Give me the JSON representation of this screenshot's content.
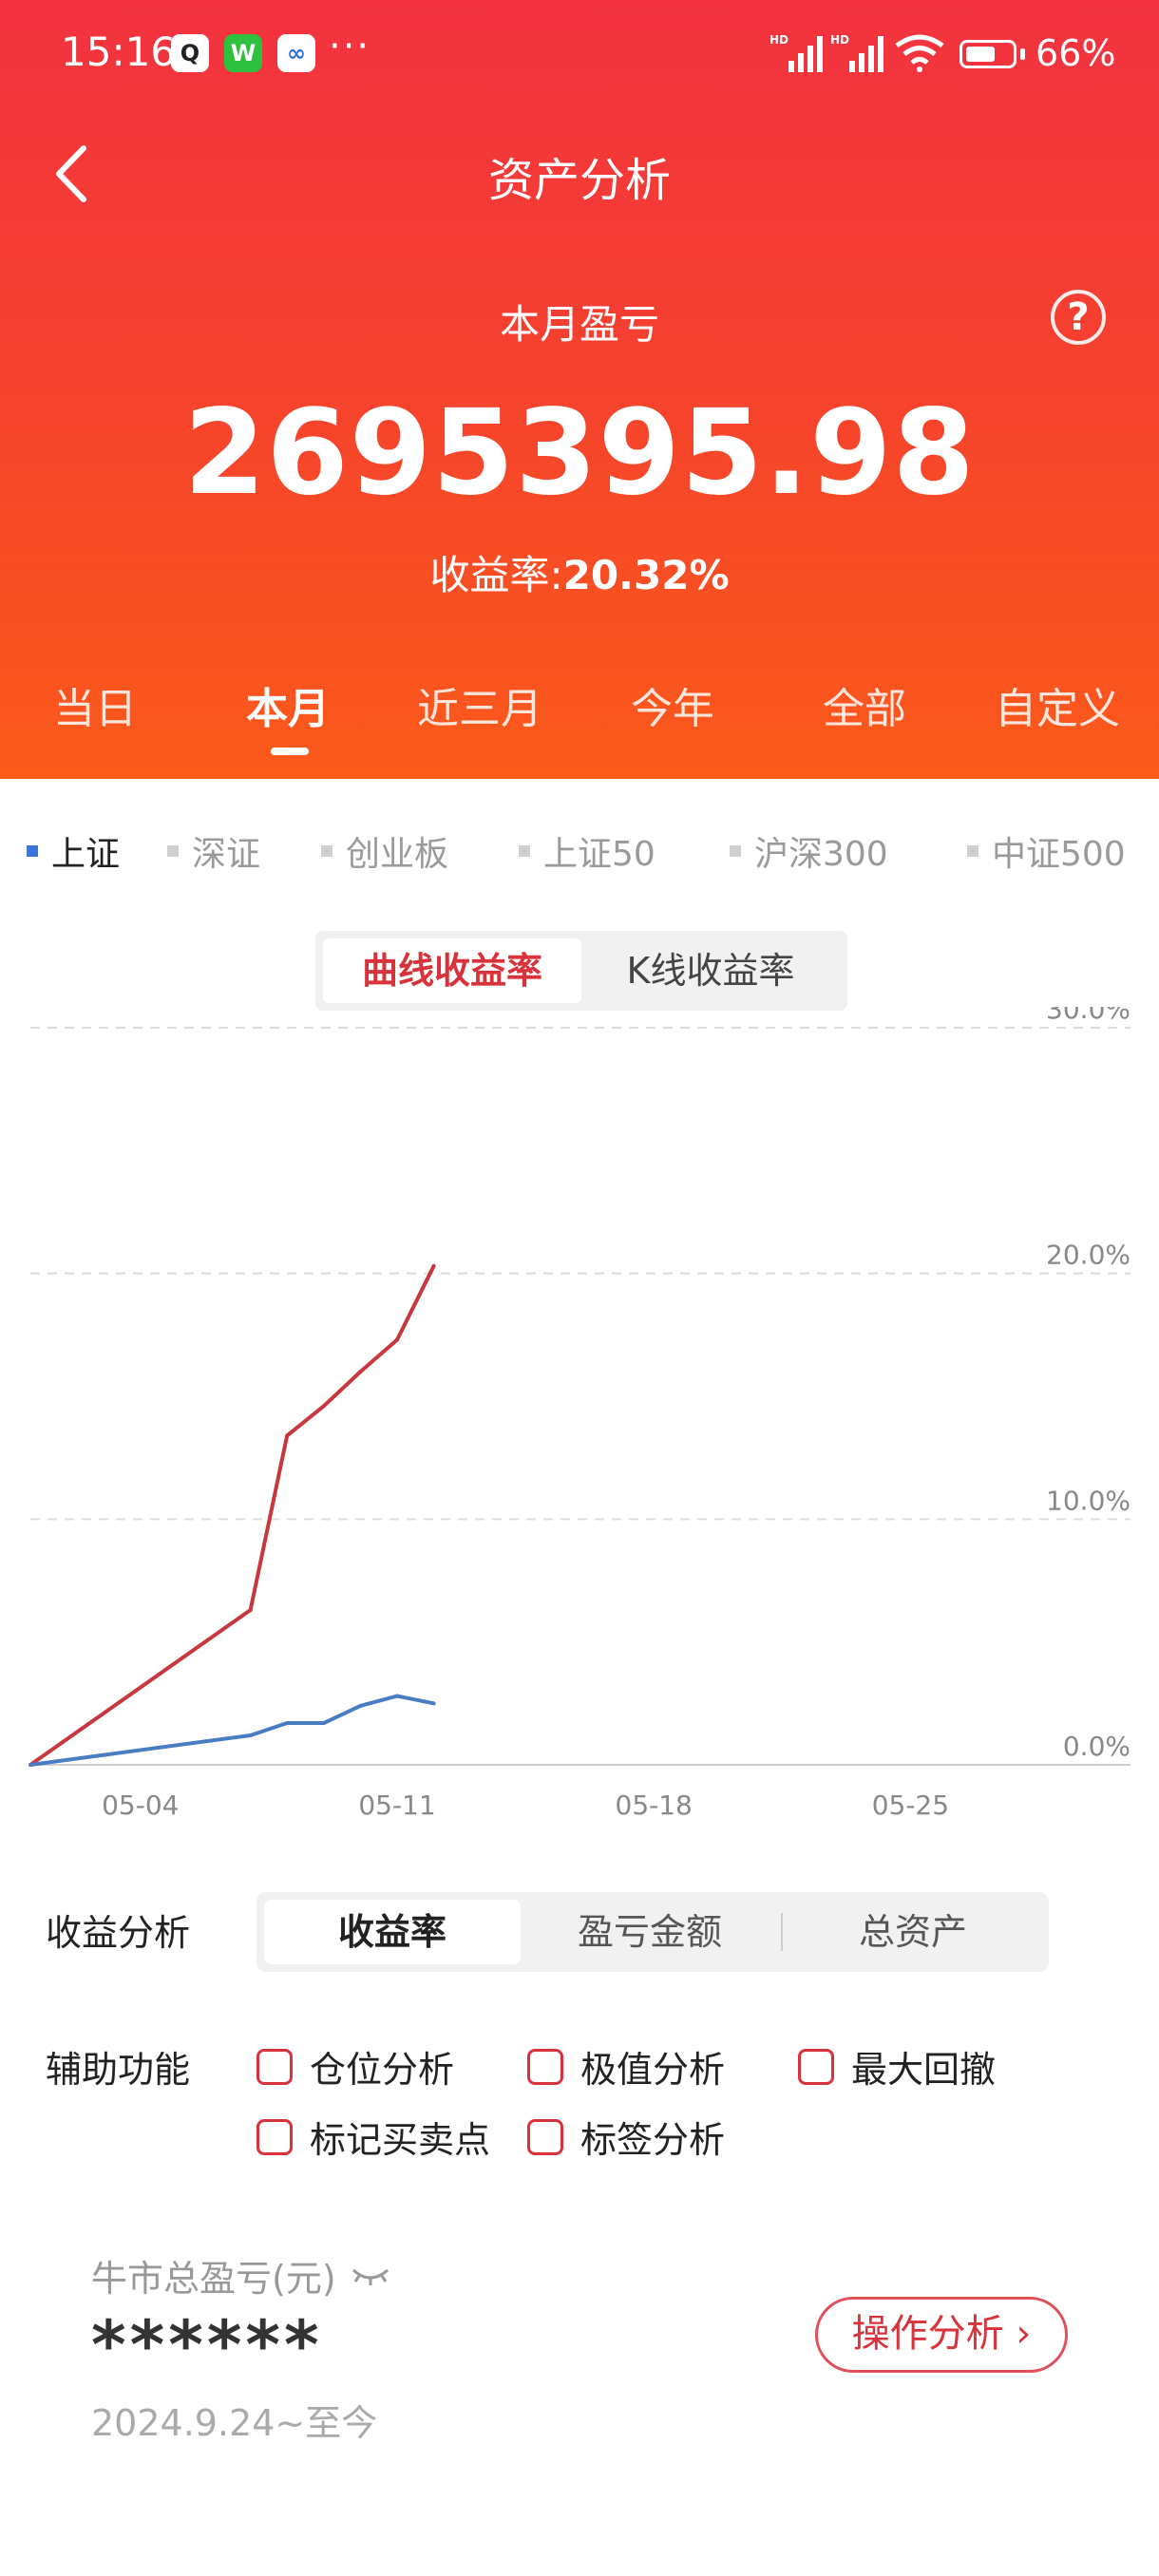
{
  "status_bar": {
    "time": "15:16",
    "more": "···",
    "battery": "66%",
    "signal_labels": [
      "HD",
      "HD"
    ]
  },
  "header": {
    "title": "资产分析",
    "subtitle": "本月盈亏",
    "value": "2695395.98",
    "rate_label": "收益率:",
    "rate_value": "20.32%",
    "help": "?"
  },
  "period_tabs": [
    "当日",
    "本月",
    "近三月",
    "今年",
    "全部",
    "自定义"
  ],
  "active_period_tab": 1,
  "indices": [
    "上证",
    "深证",
    "创业板",
    "上证50",
    "沪深300",
    "中证500"
  ],
  "active_index": 0,
  "chart_mode": {
    "curve": "曲线收益率",
    "kline": "K线收益率",
    "active": "curve"
  },
  "chart_data": {
    "type": "line",
    "x": [
      "05-01",
      "05-07",
      "05-08",
      "05-09",
      "05-10",
      "05-11",
      "05-12"
    ],
    "series": [
      {
        "values": [
          0.0,
          6.3,
          13.4,
          14.6,
          16.0,
          17.3,
          20.3
        ],
        "color": "#c8363e"
      },
      {
        "values": [
          0.0,
          1.2,
          1.7,
          1.7,
          2.4,
          2.8,
          2.5
        ],
        "color": "#4a7cc4"
      }
    ],
    "x_ticks": [
      "05-04",
      "05-11",
      "05-18",
      "05-25"
    ],
    "y_ticks": [
      "30.0%",
      "20.0%",
      "10.0%",
      "0.0%"
    ],
    "ylim": [
      0,
      30
    ],
    "xlim": [
      "05-01",
      "05-31"
    ],
    "grid": true
  },
  "analysis": {
    "label": "收益分析",
    "options": [
      "收益率",
      "盈亏金额",
      "总资产"
    ],
    "active": 0
  },
  "aux": {
    "label": "辅助功能",
    "options": [
      "仓位分析",
      "极值分析",
      "最大回撤",
      "标记买卖点",
      "标签分析"
    ]
  },
  "bull": {
    "label": "牛市总盈亏(元)",
    "value": "******",
    "period": "2024.9.24~至今",
    "button": "操作分析 ›"
  }
}
